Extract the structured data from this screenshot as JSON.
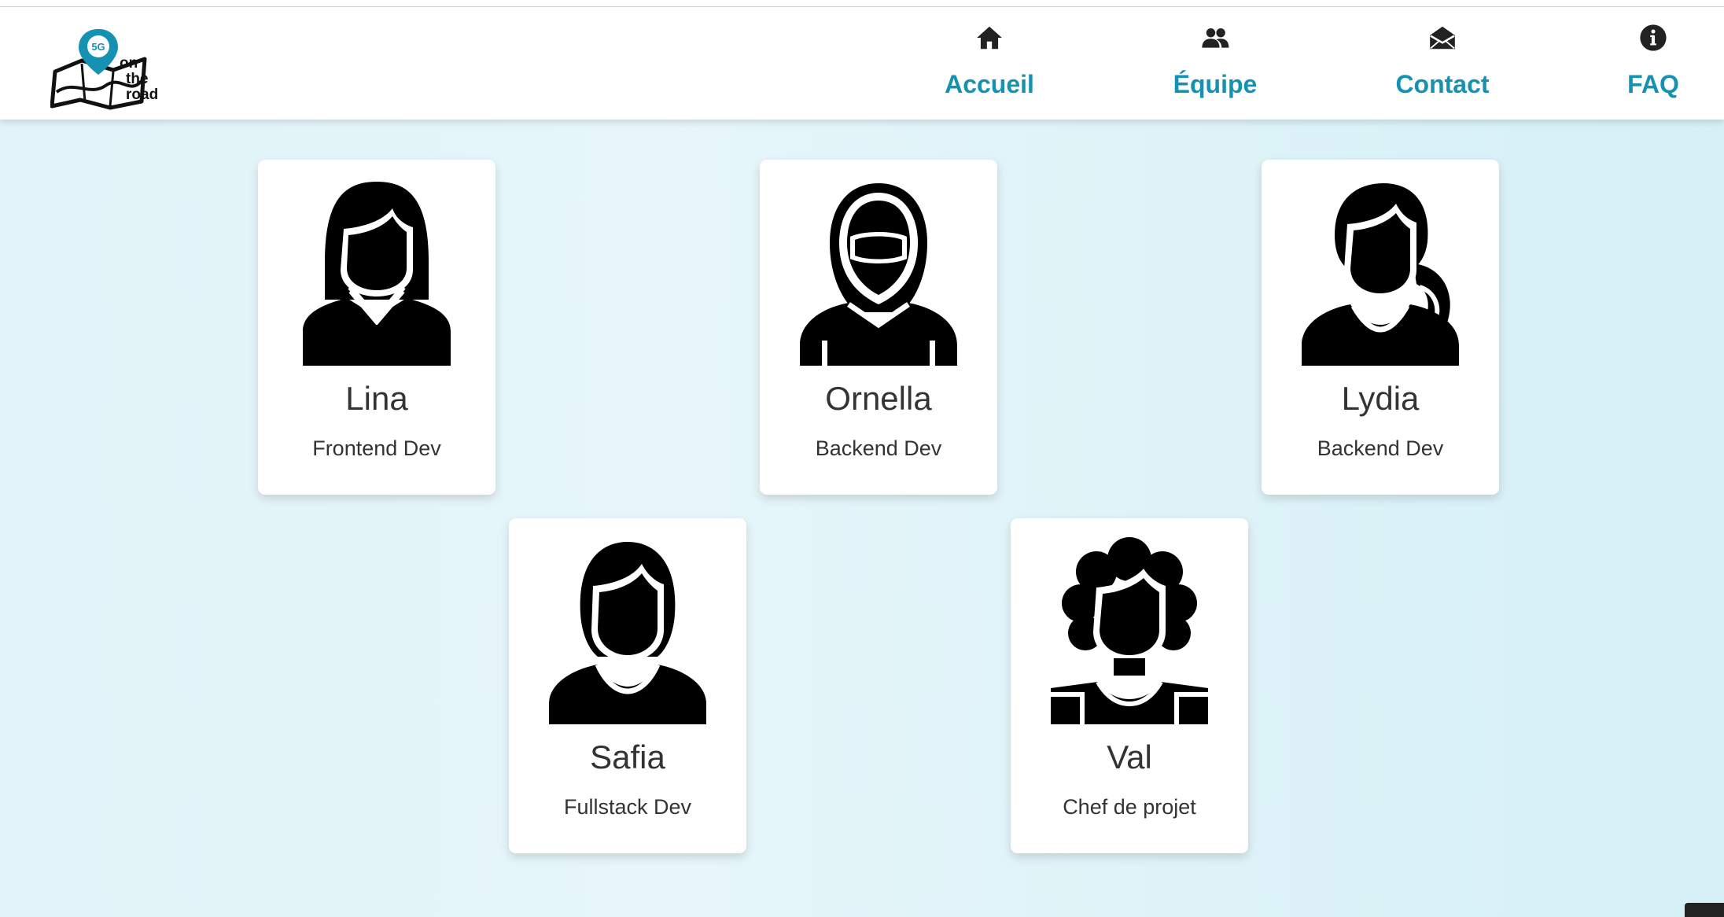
{
  "logo": {
    "badge": "5G",
    "words": [
      "on",
      "the",
      "road"
    ]
  },
  "nav": [
    {
      "label": "Accueil",
      "icon": "home-icon"
    },
    {
      "label": "Équipe",
      "icon": "users-icon"
    },
    {
      "label": "Contact",
      "icon": "envelope-open-icon"
    },
    {
      "label": "FAQ",
      "icon": "info-circle-icon"
    }
  ],
  "team": [
    {
      "name": "Lina",
      "role": "Frontend Dev",
      "avatar": "woman-long-hair-avatar-icon"
    },
    {
      "name": "Ornella",
      "role": "Backend Dev",
      "avatar": "woman-hijab-avatar-icon"
    },
    {
      "name": "Lydia",
      "role": "Backend Dev",
      "avatar": "woman-ponytail-avatar-icon"
    },
    {
      "name": "Safia",
      "role": "Fullstack Dev",
      "avatar": "woman-bob-hair-avatar-icon"
    },
    {
      "name": "Val",
      "role": "Chef de projet",
      "avatar": "woman-curly-hair-avatar-icon"
    }
  ],
  "colors": {
    "accent": "#1592b1",
    "text": "#333333",
    "card": "#ffffff",
    "background": "#e2f4f9"
  }
}
